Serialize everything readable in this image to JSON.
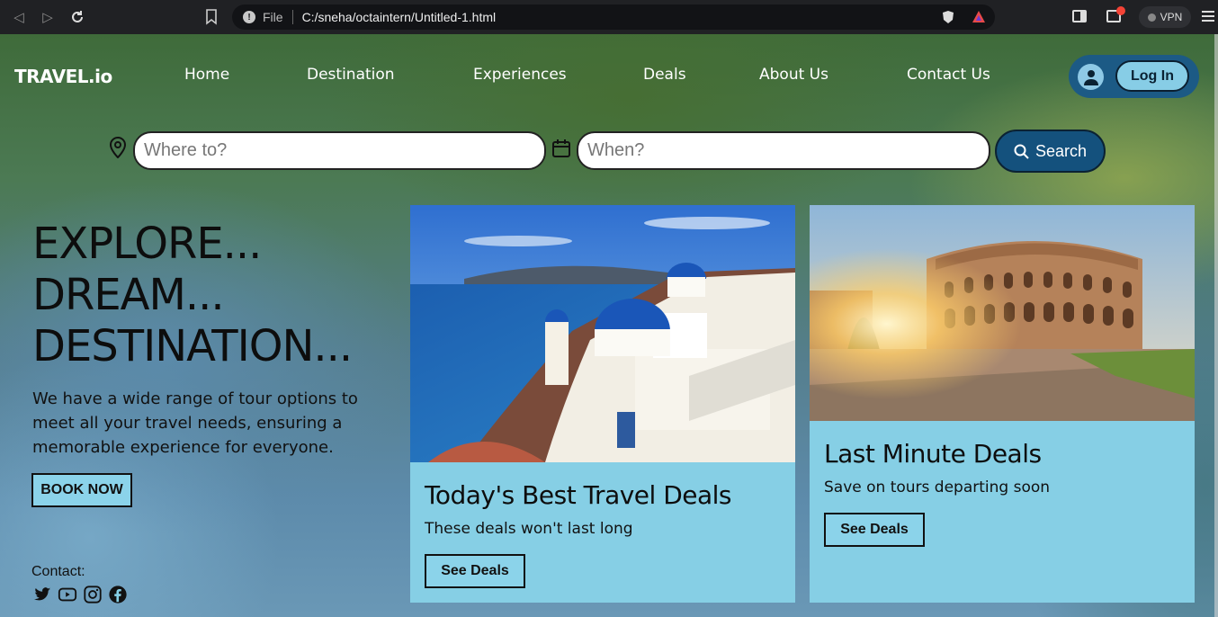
{
  "browser": {
    "file_label": "File",
    "url": "C:/sneha/octaintern/Untitled-1.html",
    "vpn_label": "VPN"
  },
  "header": {
    "logo": "TRAVEL.io",
    "nav": [
      "Home",
      "Destination",
      "Experiences",
      "Deals",
      "About Us",
      "Contact Us"
    ],
    "login_label": "Log In"
  },
  "search": {
    "where_placeholder": "Where to?",
    "when_placeholder": "When?",
    "button_label": "Search"
  },
  "hero": {
    "title_lines": [
      "EXPLORE...",
      "DREAM...",
      "DESTINATION..."
    ],
    "subtitle": "We have a wide range of tour options to meet all your travel needs, ensuring a memorable experience for everyone.",
    "book_label": "BOOK NOW",
    "contact_label": "Contact:",
    "social_icons": [
      "twitter-icon",
      "youtube-icon",
      "instagram-icon",
      "facebook-icon"
    ]
  },
  "cards": [
    {
      "title": "Today's Best Travel Deals",
      "subtitle": "These deals won't last long",
      "button": "See Deals"
    },
    {
      "title": "Last Minute Deals",
      "subtitle": "Save on tours departing soon",
      "button": "See Deals"
    }
  ],
  "colors": {
    "card_bg": "#86cfe5",
    "accent_dark": "#14517d",
    "button_bg": "#8bd3ea"
  }
}
